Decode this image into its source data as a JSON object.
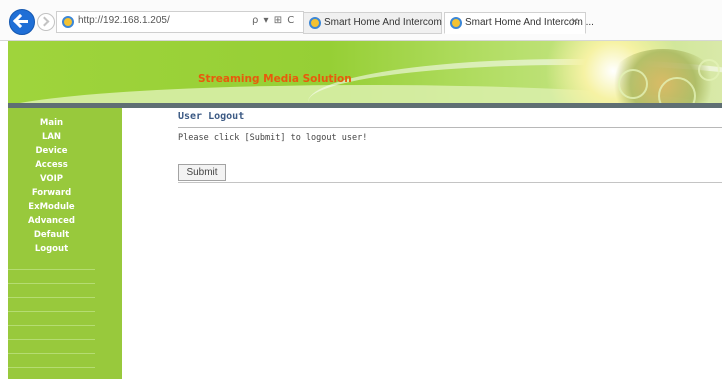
{
  "browser": {
    "url": "http://192.168.1.205/",
    "address_tools": "ρ ▾ ⊞ C",
    "tabs": [
      {
        "label": "Smart Home And Intercom Sys...",
        "active": false
      },
      {
        "label": "Smart Home And Intercom ...",
        "active": true
      }
    ],
    "tab_close": "×"
  },
  "banner": {
    "title": "Streaming Media Solution"
  },
  "sidebar": {
    "items": [
      {
        "label": "Main"
      },
      {
        "label": "LAN"
      },
      {
        "label": "Device"
      },
      {
        "label": "Access"
      },
      {
        "label": "VOIP"
      },
      {
        "label": "Forward"
      },
      {
        "label": "ExModule"
      },
      {
        "label": "Advanced"
      },
      {
        "label": "Default"
      },
      {
        "label": "Logout"
      }
    ]
  },
  "main": {
    "heading": "User Logout",
    "description": "Please click [Submit] to logout user!",
    "submit_label": "Submit"
  },
  "colors": {
    "sidebar": "#98c93c",
    "banner_title": "#e85a0c",
    "heading": "#3c5a84",
    "browser_back": "#1f6fd6"
  }
}
